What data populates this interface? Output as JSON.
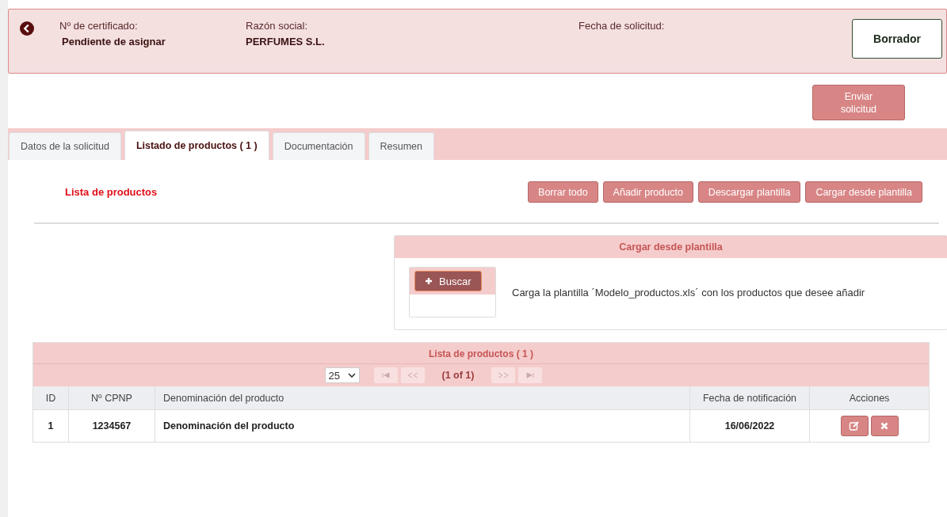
{
  "header": {
    "fields": [
      {
        "label": "Nº de certificado:",
        "value": "Pendiente de asignar"
      },
      {
        "label": "Razón social:",
        "value": "PERFUMES S.L."
      },
      {
        "label": "Fecha de solicitud:"
      }
    ],
    "status": "Borrador"
  },
  "send_button": [
    "Enviar",
    "solicitud"
  ],
  "tabs": [
    {
      "label": "Datos de la solicitud",
      "selected": false
    },
    {
      "label": "Listado de productos ( 1 )",
      "selected": true
    },
    {
      "label": "Documentación",
      "selected": false
    },
    {
      "label": "Resumen",
      "selected": false
    }
  ],
  "section_title": "Lista de productos",
  "actions": [
    "Borrar todo",
    "Añadir producto",
    "Descargar plantilla",
    "Cargar desde plantilla"
  ],
  "upload_panel": {
    "title": "Cargar desde plantilla",
    "button": "Buscar",
    "hint": "Carga la plantilla ´Modelo_productos.xls´ con los productos que desee añadir"
  },
  "table": {
    "title": "Lista de productos ( 1 )",
    "page_size": "25",
    "page_info": "(1 of 1)",
    "columns": [
      "ID",
      "Nº CPNP",
      "Denominación del producto",
      "Fecha de notificación",
      "Acciones"
    ],
    "rows": [
      {
        "id": "1",
        "cpnp": "1234567",
        "name": "Denominación del producto",
        "date": "16/06/2022"
      }
    ]
  }
}
